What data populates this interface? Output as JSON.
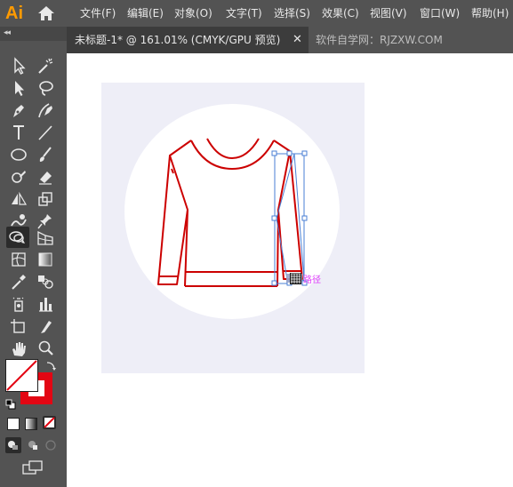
{
  "app": {
    "logo": "Ai"
  },
  "menu": {
    "items": [
      "文件(F)",
      "编辑(E)",
      "对象(O)",
      "文字(T)",
      "选择(S)",
      "效果(C)",
      "视图(V)",
      "窗口(W)",
      "帮助(H)"
    ]
  },
  "tabs": {
    "active_label": "未标题-1* @ 161.01% (CMYK/GPU 预览)",
    "close_glyph": "✕",
    "inactive_label": "软件自学网：RJZXW.COM"
  },
  "toolbar": {
    "collapse": "◂◂",
    "tools": [
      "selection-tool",
      "magic-wand-tool",
      "direct-selection-tool",
      "lasso-tool",
      "pen-tool",
      "curvature-tool",
      "type-tool",
      "line-segment-tool",
      "ellipse-tool",
      "paintbrush-tool",
      "shaper-tool",
      "eraser-tool",
      "reflect-tool",
      "scale-tool",
      "warp-tool",
      "puppet-warp-tool",
      "shape-builder-tool",
      "perspective-grid-tool",
      "mesh-tool",
      "gradient-tool",
      "eyedropper-tool",
      "blend-tool",
      "symbol-sprayer-tool",
      "column-graph-tool",
      "artboard-tool",
      "slice-tool",
      "hand-tool",
      "zoom-tool"
    ],
    "active_tool": "shape-builder-tool"
  },
  "colors": {
    "fill": "none",
    "stroke": "#e30613",
    "artwork_stroke": "#cc0000",
    "selection": "#4a7fd4",
    "artboard": "#eeeef7",
    "hint": "#e040fb"
  },
  "canvas": {
    "cursor_hint": "路径"
  }
}
